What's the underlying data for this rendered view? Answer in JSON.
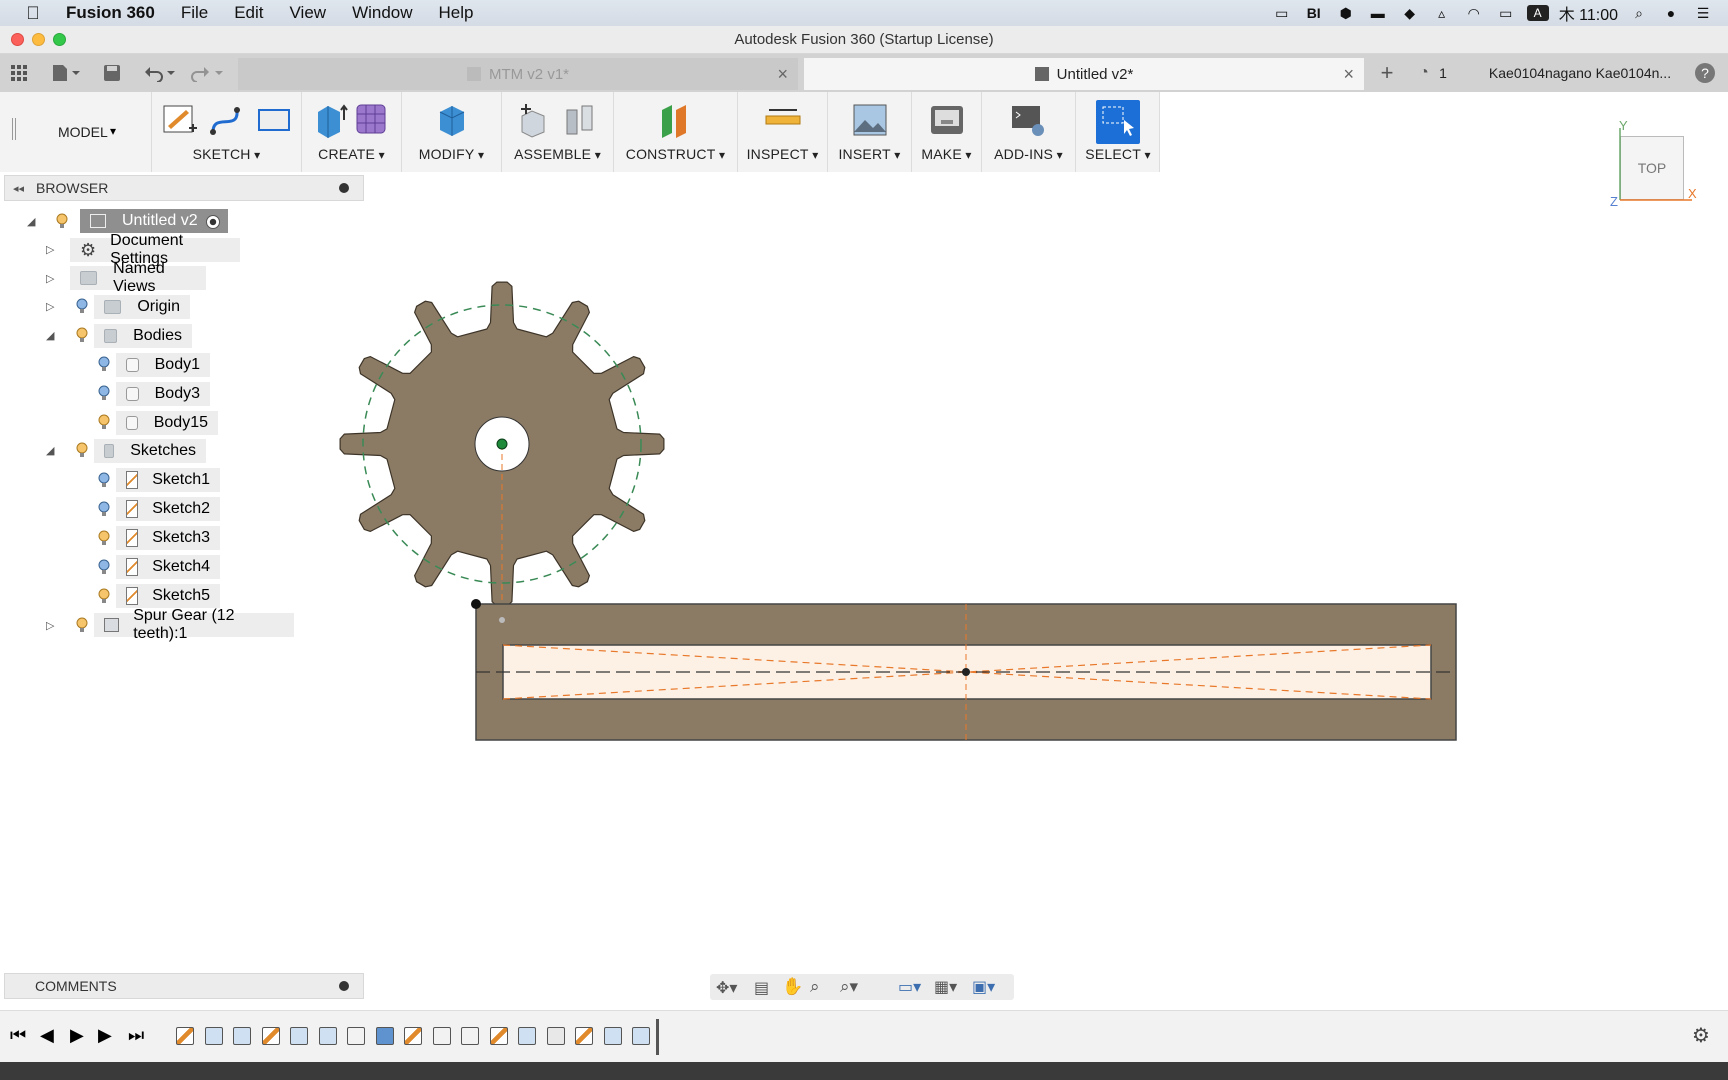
{
  "menubar": {
    "app_name": "Fusion 360",
    "items": [
      "File",
      "Edit",
      "View",
      "Window",
      "Help"
    ],
    "clock": "木 11:00"
  },
  "window": {
    "title": "Autodesk Fusion 360 (Startup License)"
  },
  "tabs": [
    {
      "label": "MTM v2 v1*",
      "active": false
    },
    {
      "label": "Untitled v2*",
      "active": true
    }
  ],
  "tabbar": {
    "job_count": "1",
    "user": "Kae0104nagano Kae0104n..."
  },
  "toolbar": {
    "workspace": "MODEL",
    "groups": [
      "SKETCH",
      "CREATE",
      "MODIFY",
      "ASSEMBLE",
      "CONSTRUCT",
      "INSPECT",
      "INSERT",
      "MAKE",
      "ADD-INS",
      "SELECT"
    ]
  },
  "browser": {
    "title": "BROWSER",
    "root": "Untitled v2",
    "items": {
      "document_settings": "Document Settings",
      "named_views": "Named Views",
      "origin": "Origin",
      "bodies": "Bodies",
      "body1": "Body1",
      "body3": "Body3",
      "body15": "Body15",
      "sketches": "Sketches",
      "sketch1": "Sketch1",
      "sketch2": "Sketch2",
      "sketch3": "Sketch3",
      "sketch4": "Sketch4",
      "sketch5": "Sketch5",
      "spur_gear": "Spur Gear (12 teeth):1"
    }
  },
  "comments": {
    "title": "COMMENTS"
  },
  "viewcube": {
    "face": "TOP",
    "axis_x": "X",
    "axis_y": "Y",
    "axis_z": "Z"
  },
  "colors": {
    "body_fill": "#8b7b65",
    "sketch_profile": "#fdf1e6",
    "construction_line": "#e8782a",
    "select_blue": "#1c6fd6"
  }
}
